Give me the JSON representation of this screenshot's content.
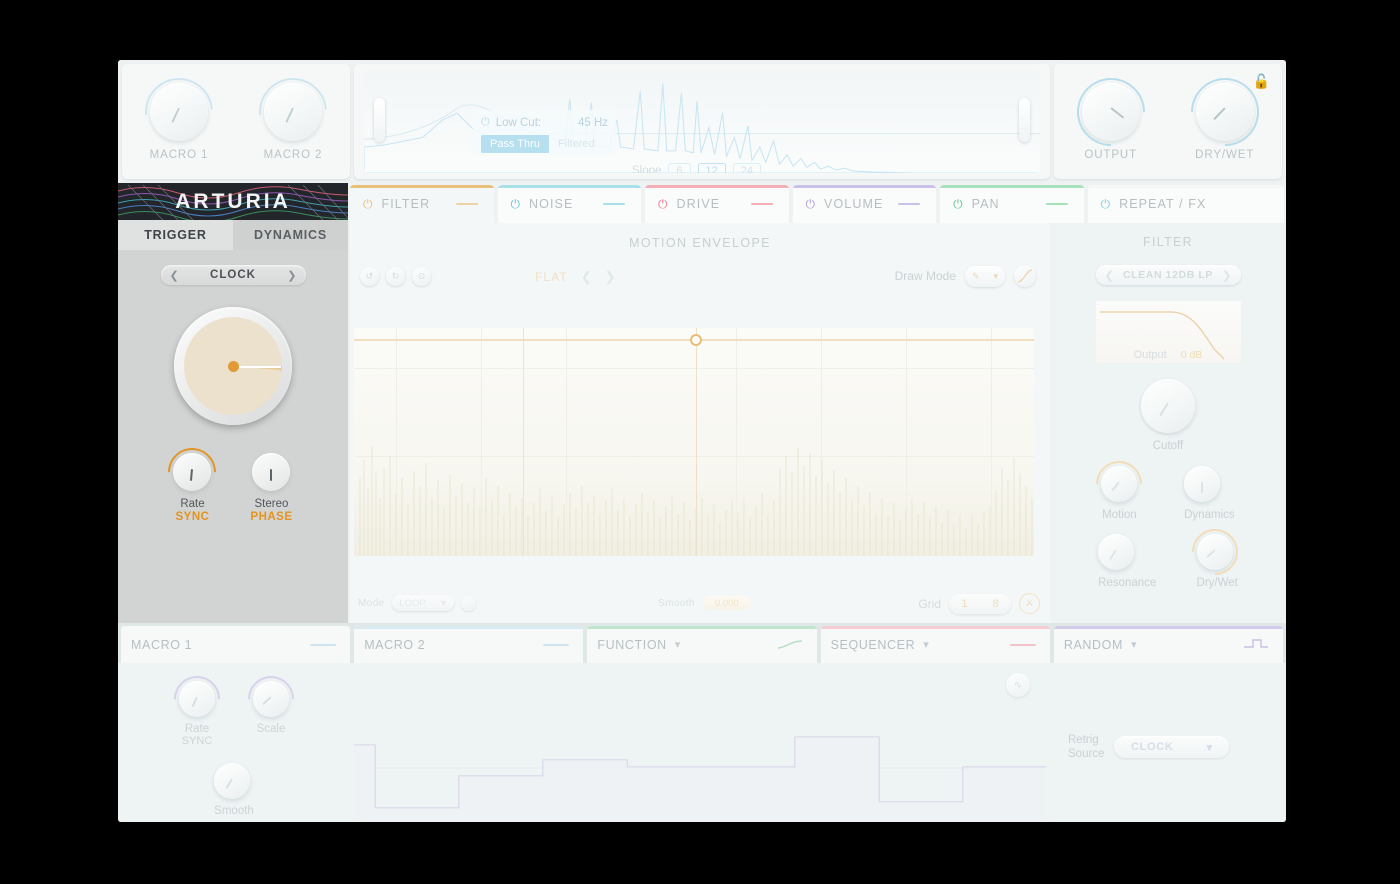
{
  "brand": {
    "name": "ARTURIA"
  },
  "top_bar": {
    "macros": [
      {
        "label": "MACRO 1",
        "value_deg": 205
      },
      {
        "label": "MACRO 2",
        "value_deg": 205
      }
    ],
    "filter_display": {
      "low_cut_label": "Low Cut:",
      "low_cut_value": "45 Hz",
      "power_icon": "power-icon",
      "routing_options": [
        "Pass Thru",
        "Filtered"
      ],
      "routing_selected": "Pass Thru",
      "slope_label": "Slope",
      "slope_options": [
        "6",
        "12",
        "24"
      ],
      "slope_selected": "12"
    },
    "output": [
      {
        "label": "OUTPUT",
        "value_deg": 128
      },
      {
        "label": "DRY/WET",
        "value_deg": 224
      }
    ],
    "lock_icon": "unlock-icon"
  },
  "sidebar": {
    "tabs": [
      {
        "label": "TRIGGER",
        "active": true
      },
      {
        "label": "DYNAMICS",
        "active": false
      }
    ],
    "source_selector": {
      "value": "CLOCK",
      "prev_icon": "chevron-left-icon",
      "next_icon": "chevron-right-icon"
    },
    "big_knob": {
      "value_deg": 95
    },
    "knobs": [
      {
        "label": "Rate",
        "sub": "SYNC",
        "value_deg": 185
      },
      {
        "label": "Stereo",
        "sub": "PHASE",
        "value_deg": 180
      }
    ]
  },
  "main_tabs": [
    {
      "label": "FILTER",
      "color": "#e8c07a",
      "active": true
    },
    {
      "label": "NOISE",
      "color": "#8ed3e0",
      "active": false
    },
    {
      "label": "DRIVE",
      "color": "#f08a96",
      "active": false
    },
    {
      "label": "VOLUME",
      "color": "#b9aee0",
      "active": false
    },
    {
      "label": "PAN",
      "color": "#8ed8a8",
      "active": false
    },
    {
      "label": "REPEAT / FX",
      "color": "#8ed3e0",
      "active": false
    }
  ],
  "motion_envelope": {
    "title": "MOTION ENVELOPE",
    "tool_icons": [
      "undo-icon",
      "redo-icon",
      "reset-icon"
    ],
    "preset_name": "FLAT",
    "preset_prev_icon": "chevron-left-icon",
    "preset_next_icon": "chevron-right-icon",
    "draw_mode_label": "Draw Mode",
    "draw_mode_value": "pen-icon",
    "draw_mode_chevron": "chevron-down-icon",
    "curve_icon": "curve-icon",
    "mode_label": "Mode",
    "mode_value": "LOOP",
    "bell_icon": "bell-icon",
    "smooth_label": "Smooth",
    "smooth_value": "0.000",
    "grid_label": "Grid",
    "grid_numerator": "1",
    "grid_denominator": "8",
    "grid_lock_icon": "grid-lock-icon"
  },
  "filter_panel": {
    "title": "FILTER",
    "type_selector": {
      "value": "CLEAN 12DB LP",
      "prev_icon": "chevron-left-icon",
      "next_icon": "chevron-right-icon"
    },
    "graph": {
      "output_label": "Output",
      "output_value": "0 dB"
    },
    "cutoff": {
      "label": "Cutoff",
      "value_deg": 212
    },
    "small_knobs": [
      {
        "label": "Motion",
        "value_deg": 218
      },
      {
        "label": "Dynamics",
        "value_deg": 180
      },
      {
        "label": "Resonance",
        "value_deg": 212
      },
      {
        "label": "Dry/Wet",
        "value_deg": 228
      }
    ]
  },
  "bottom_tabs": [
    {
      "label": "MACRO 1",
      "color": "#bcd8e8",
      "has_chevron": false,
      "wave": "dash",
      "active": true
    },
    {
      "label": "MACRO 2",
      "color": "#bcd8e8",
      "has_chevron": false,
      "wave": "dash",
      "active": false
    },
    {
      "label": "FUNCTION",
      "color": "#a8ddb6",
      "has_chevron": true,
      "wave": "curve",
      "active": false
    },
    {
      "label": "SEQUENCER",
      "color": "#f3b9c0",
      "has_chevron": true,
      "wave": "dash",
      "active": false
    },
    {
      "label": "RANDOM",
      "color": "#c3bbe4",
      "has_chevron": true,
      "wave": "step",
      "active": false
    }
  ],
  "macro1_panel": {
    "knobs": [
      {
        "label": "Rate",
        "sub": "SYNC",
        "value_deg": 205
      },
      {
        "label": "Scale",
        "sub": "",
        "value_deg": 228
      },
      {
        "label": "Smooth",
        "sub": "",
        "value_deg": 212
      }
    ]
  },
  "sequencer_panel": {
    "icon": "waveform-icon",
    "steps": [
      1.0,
      0.22,
      0.46,
      0.6,
      0.57,
      0.57,
      0.57,
      1.0,
      0.22,
      0.57
    ]
  },
  "random_panel": {
    "retrig_label_line1": "Retrig",
    "retrig_label_line2": "Source",
    "retrig_value": "CLOCK",
    "retrig_chevron": "chevron-down-icon"
  }
}
